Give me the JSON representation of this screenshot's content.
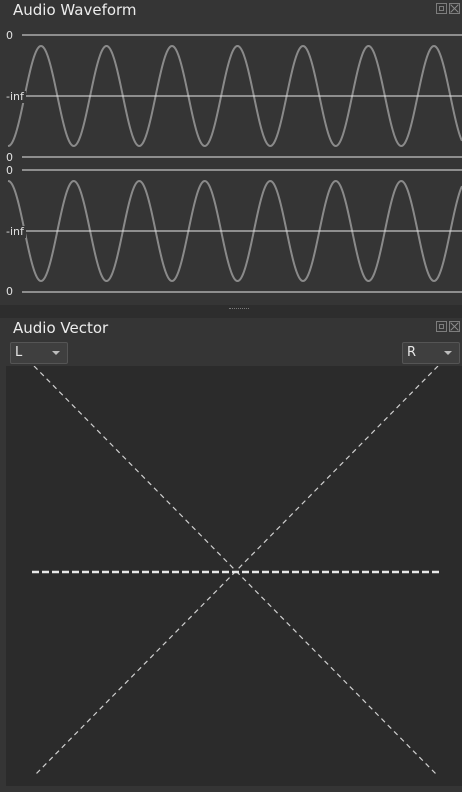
{
  "waveform": {
    "title": "Audio Waveform",
    "channels": [
      {
        "top_label": "0",
        "mid_label": "-inf",
        "bottom_label": "0"
      },
      {
        "top_label": "0",
        "mid_label": "-inf",
        "bottom_label": "0"
      }
    ]
  },
  "vector": {
    "title": "Audio Vector",
    "left_channel": "L",
    "right_channel": "R"
  },
  "icons": {
    "float": "float-icon",
    "close": "close-icon",
    "dropdown": "chevron-down-icon"
  },
  "colors": {
    "panel_bg": "#353535",
    "wave": "#8a8a8a",
    "axis_line": "#e8e8e8",
    "vector_line": "#d8d8d8"
  }
}
